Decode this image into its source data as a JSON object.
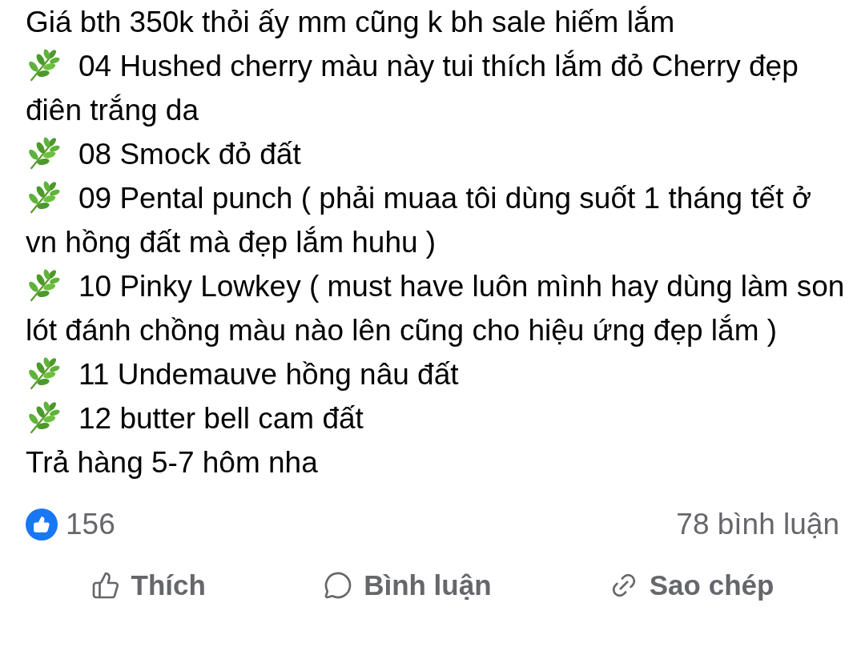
{
  "post": {
    "lines": [
      {
        "kind": "plain",
        "text": "Giá bth 350k thỏi ấy mm cũng k bh sale hiếm lắm"
      },
      {
        "kind": "herb",
        "text": "04 Hushed cherry màu này tui thích lắm đỏ Cherry đẹp điên trắng da"
      },
      {
        "kind": "herb",
        "text": "08 Smock đỏ đất"
      },
      {
        "kind": "herb",
        "text": "09 Pental punch ( phải muaa tôi dùng suốt 1 tháng tết ở vn hồng đất mà đẹp lắm huhu )"
      },
      {
        "kind": "herb",
        "text": "10 Pinky Lowkey ( must have luôn mình hay dùng  làm son lót đánh chồng màu nào lên cũng cho hiệu ứng đẹp lắm )"
      },
      {
        "kind": "herb",
        "text": "11 Undemauve hồng nâu đất"
      },
      {
        "kind": "herb",
        "text": "12 butter bell cam đất"
      },
      {
        "kind": "plain",
        "text": "Trả hàng 5-7 hôm nha"
      }
    ]
  },
  "reactions": {
    "likes": "156",
    "comments": "78 bình luận"
  },
  "actions": [
    {
      "kind": "like",
      "label": "Thích"
    },
    {
      "kind": "comment",
      "label": "Bình luận"
    },
    {
      "kind": "copy",
      "label": "Sao chép"
    }
  ]
}
